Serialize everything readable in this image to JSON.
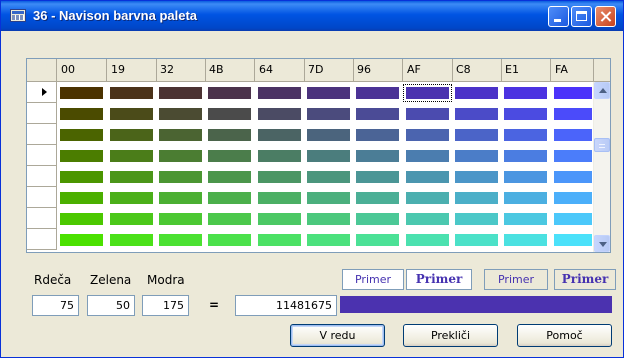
{
  "window": {
    "title": "36 - Navison barvna paleta",
    "icon": "table-window-icon",
    "controls": [
      "minimize-icon",
      "maximize-icon",
      "close-icon"
    ]
  },
  "palette": {
    "columns": [
      "00",
      "19",
      "32",
      "4B",
      "64",
      "7D",
      "96",
      "AF",
      "C8",
      "E1",
      "FA"
    ],
    "selected_row": 0,
    "selected_column": 7,
    "rows": [
      [
        "#4b3200",
        "#4b3219",
        "#4b3232",
        "#4b324b",
        "#4b3264",
        "#4b327d",
        "#4b3296",
        "#4b32af",
        "#4b32c8",
        "#4b32e1",
        "#4b32fa"
      ],
      [
        "#4b4b00",
        "#4b4b19",
        "#4b4b32",
        "#4b4b4b",
        "#4b4b64",
        "#4b4b7d",
        "#4b4b96",
        "#4b4baf",
        "#4b4bc8",
        "#4b4be1",
        "#4b4bfa"
      ],
      [
        "#4b6400",
        "#4b6419",
        "#4b6432",
        "#4b644b",
        "#4b6464",
        "#4b647d",
        "#4b6496",
        "#4b64af",
        "#4b64c8",
        "#4b64e1",
        "#4b64fa"
      ],
      [
        "#4b7d00",
        "#4b7d19",
        "#4b7d32",
        "#4b7d4b",
        "#4b7d64",
        "#4b7d7d",
        "#4b7d96",
        "#4b7daf",
        "#4b7dc8",
        "#4b7de1",
        "#4b7dfa"
      ],
      [
        "#4b9600",
        "#4b9619",
        "#4b9632",
        "#4b964b",
        "#4b9664",
        "#4b967d",
        "#4b9696",
        "#4b96af",
        "#4b96c8",
        "#4b96e1",
        "#4b96fa"
      ],
      [
        "#4baf00",
        "#4baf19",
        "#4baf32",
        "#4baf4b",
        "#4baf64",
        "#4baf7d",
        "#4baf96",
        "#4bafaf",
        "#4bafc8",
        "#4bafe1",
        "#4baffa"
      ],
      [
        "#4bc800",
        "#4bc819",
        "#4bc832",
        "#4bc84b",
        "#4bc864",
        "#4bc87d",
        "#4bc896",
        "#4bc8af",
        "#4bc8c8",
        "#4bc8e1",
        "#4bc8fa"
      ],
      [
        "#4be100",
        "#4be119",
        "#4be132",
        "#4be14b",
        "#4be164",
        "#4be17d",
        "#4be196",
        "#4be1af",
        "#4be1c8",
        "#4be1e1",
        "#4be1fa"
      ]
    ]
  },
  "labels": {
    "red": "Rdeča",
    "green": "Zelena",
    "blue": "Modra"
  },
  "values": {
    "red": "75",
    "green": "50",
    "blue": "175",
    "equals": "=",
    "color_code": "11481675"
  },
  "preview": {
    "samples": [
      "Primer",
      "Primer",
      "Primer",
      "Primer"
    ],
    "text_color": "#4632b0",
    "swatch_color": "#4b32af"
  },
  "buttons": {
    "ok": "V redu",
    "cancel": "Prekliči",
    "help": "Pomoč"
  }
}
